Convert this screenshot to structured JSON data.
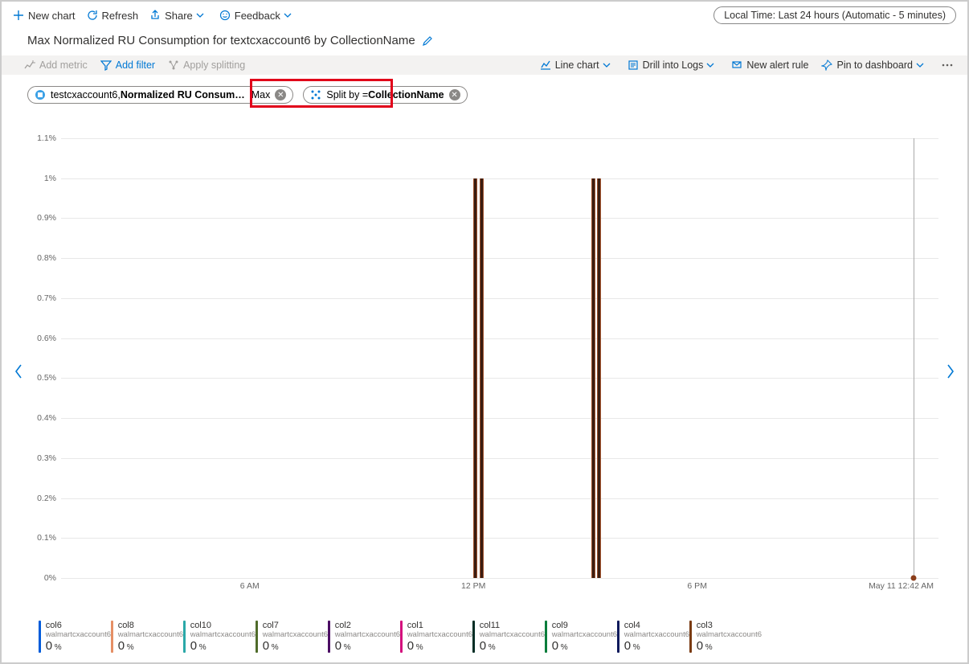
{
  "topbar": {
    "new_chart": "New chart",
    "refresh": "Refresh",
    "share": "Share",
    "feedback": "Feedback",
    "time_range": "Local Time: Last 24 hours (Automatic - 5 minutes)"
  },
  "title": "Max Normalized RU Consumption for textcxaccount6 by CollectionName",
  "secbar": {
    "add_metric": "Add metric",
    "add_filter": "Add filter",
    "apply_splitting": "Apply splitting",
    "line_chart": "Line chart",
    "drill_logs": "Drill into Logs",
    "new_alert": "New alert rule",
    "pin_dash": "Pin to dashboard"
  },
  "pills": {
    "metric_prefix": "testcxaccount6, ",
    "metric_name": "Normalized RU Consum…",
    "metric_agg": "Max",
    "split_prefix": "Split by = ",
    "split_value": "CollectionName"
  },
  "chart_data": {
    "type": "line",
    "title": "Max Normalized RU Consumption for textcxaccount6 by CollectionName",
    "ylabel": "Max Normalized RU Consumption",
    "xlabel": "",
    "ylim": [
      0,
      1.1
    ],
    "y_ticks": [
      "0%",
      "0.1%",
      "0.2%",
      "0.3%",
      "0.4%",
      "0.5%",
      "0.6%",
      "0.7%",
      "0.8%",
      "0.9%",
      "1%",
      "1.1%"
    ],
    "x_ticks": [
      {
        "pos_pct": 21.5,
        "label": "6 AM"
      },
      {
        "pos_pct": 47.0,
        "label": "12 PM"
      },
      {
        "pos_pct": 72.5,
        "label": "6 PM"
      }
    ],
    "timestamp_label": "May 11 12:42 AM",
    "cursor_x_pct": 97.2,
    "spikes": [
      {
        "x_pct": 47.2,
        "height_pct": 100
      },
      {
        "x_pct": 47.9,
        "height_pct": 100
      },
      {
        "x_pct": 60.6,
        "height_pct": 100
      },
      {
        "x_pct": 61.3,
        "height_pct": 100
      }
    ],
    "series": [
      {
        "name": "col6",
        "account": "walmartcxaccount6",
        "value": 0,
        "color": "#015cda"
      },
      {
        "name": "col8",
        "account": "walmartcxaccount6",
        "value": 0,
        "color": "#e58f65"
      },
      {
        "name": "col10",
        "account": "walmartcxaccount6",
        "value": 0,
        "color": "#2aa8a8"
      },
      {
        "name": "col7",
        "account": "walmartcxaccount6",
        "value": 0,
        "color": "#4f6b2a"
      },
      {
        "name": "col2",
        "account": "walmartcxaccount6",
        "value": 0,
        "color": "#4b0d63"
      },
      {
        "name": "col1",
        "account": "walmartcxaccount6",
        "value": 0,
        "color": "#d40f7d"
      },
      {
        "name": "col11",
        "account": "walmartcxaccount6",
        "value": 0,
        "color": "#002d24"
      },
      {
        "name": "col9",
        "account": "walmartcxaccount6",
        "value": 0,
        "color": "#0a7d3b"
      },
      {
        "name": "col4",
        "account": "walmartcxaccount6",
        "value": 0,
        "color": "#0e1a5c"
      },
      {
        "name": "col3",
        "account": "walmartcxaccount6",
        "value": 0,
        "color": "#7a3b12"
      }
    ]
  }
}
